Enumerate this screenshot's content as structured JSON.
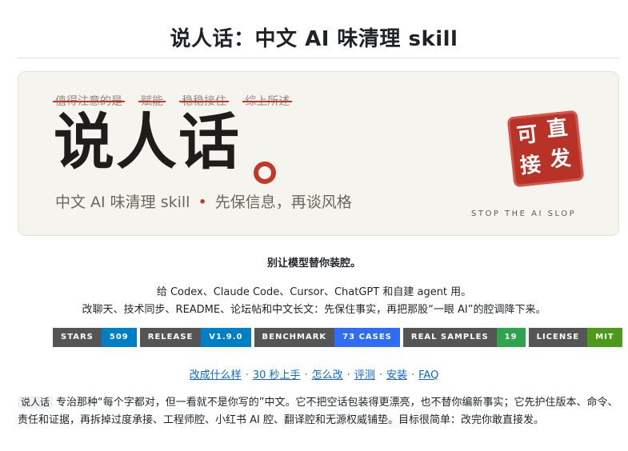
{
  "page": {
    "title": "说人话：中文 AI 味清理 skill"
  },
  "banner": {
    "struck_phrases": [
      "值得注意的是",
      "赋能",
      "稳稳接住",
      "综上所述"
    ],
    "hero_word": "说人话",
    "subtitle_left": "中文 AI 味清理 skill",
    "subtitle_sep": "•",
    "subtitle_right": "先保信息，再谈风格",
    "stamp_chars": [
      "可",
      "直",
      "接",
      "发"
    ],
    "stamp_caption": "STOP THE AI SLOP",
    "colors": {
      "accent": "#c0392b",
      "stamp": "#b83227",
      "background": "#f6f4ee"
    }
  },
  "tagline": "别让模型替你装腔。",
  "intro": {
    "line1": "给 Codex、Claude Code、Cursor、ChatGPT 和自建 agent 用。",
    "line2": "改聊天、技术同步、README、论坛帖和中文长文：先保住事实，再把那股“一眼 AI”的腔调降下来。"
  },
  "badges": [
    {
      "label": "STARS",
      "value": "509",
      "color": "#007ec6"
    },
    {
      "label": "RELEASE",
      "value": "V1.9.0",
      "color": "#007ec6"
    },
    {
      "label": "BENCHMARK",
      "value": "73 CASES",
      "color": "#2f6df6"
    },
    {
      "label": "REAL SAMPLES",
      "value": "19",
      "color": "#2ea44f"
    },
    {
      "label": "LICENSE",
      "value": "MIT",
      "color": "#4c9a1a"
    }
  ],
  "nav": {
    "links": [
      "改成什么样",
      "30 秒上手",
      "怎么改",
      "评测",
      "安装",
      "FAQ"
    ],
    "separator": "·"
  },
  "description": {
    "code": "说人话",
    "text": "专治那种“每个字都对，但一看就不是你写的”中文。它不把空话包装得更漂亮，也不替你编新事实；它先护住版本、命令、责任和证据，再拆掉过度承接、工程师腔、小红书 AI 腔、翻译腔和无源权威铺垫。目标很简单：改完你敢直接发。"
  }
}
